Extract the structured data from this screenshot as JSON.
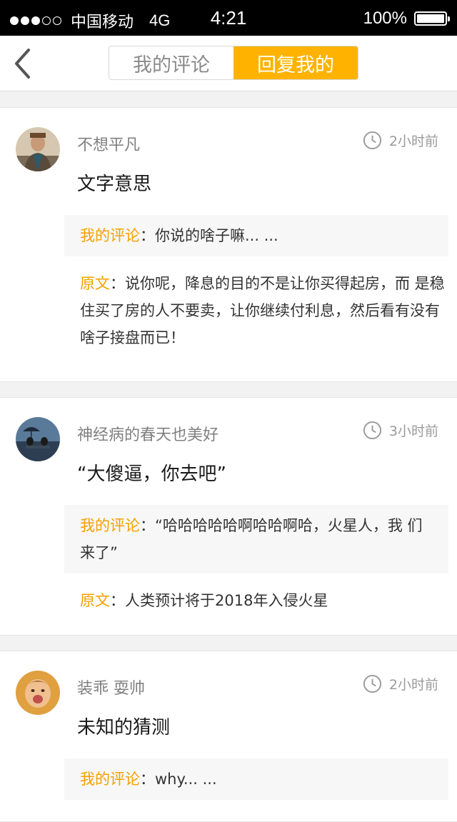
{
  "status_bar": {
    "carrier": "中国移动",
    "network": "4G",
    "time": "4:21",
    "battery": "100%"
  },
  "nav": {
    "tab_my_comments": "我的评论",
    "tab_replies_to_me": "回复我的",
    "active_tab": "回复我的"
  },
  "colors": {
    "accent": "#ffb300",
    "label": "#f5a000"
  },
  "labels": {
    "my_comment": "我的评论",
    "original": "原文",
    "colon": "："
  },
  "items": [
    {
      "username": "不想平凡",
      "time": "2小时前",
      "comment": "文字意思",
      "my_comment": "你说的啥子嘛... ...",
      "original": "说你呢，降息的目的不是让你买得起房，而 是稳住买了房的人不要卖，让你继续付利息，然后看有没有啥子接盘而已！"
    },
    {
      "username": "神经病的春天也美好",
      "time": "3小时前",
      "comment": "“大傻逼，你去吧”",
      "my_comment": "“哈哈哈哈哈啊哈哈啊哈，火星人，我 们来了”",
      "original": "人类预计将于2018年入侵火星"
    },
    {
      "username": "装乖 耍帅",
      "time": "2小时前",
      "comment": "未知的猜测",
      "my_comment": "why... ..."
    }
  ]
}
